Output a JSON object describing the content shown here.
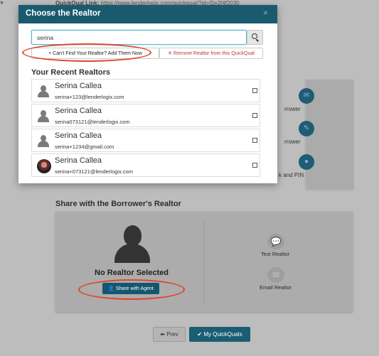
{
  "background": {
    "quickqual_link_label": "QuickQual Link:",
    "quickqual_link_url": "https://www.lenderlogix.com/quickqual/?id=f2e2f4f2030",
    "options": [
      {
        "label": "rrower",
        "icon": "email-icon"
      },
      {
        "label": "rrower",
        "icon": "text-message-icon"
      },
      {
        "label": "k and PIN",
        "icon": "lock-icon"
      }
    ]
  },
  "share_section": {
    "title": "Share with the Borrower's Realtor",
    "no_realtor": "No Realtor Selected",
    "share_button": "Share with Agent",
    "text_realtor": "Text Realtor",
    "email_realtor": "Email Realtor"
  },
  "footer": {
    "prev_label": "Prev",
    "my_quickquals_label": "My QuickQuals"
  },
  "modal": {
    "title": "Choose the Realtor",
    "close_glyph": "×",
    "search": {
      "value": "serina",
      "placeholder": ""
    },
    "add_button": "Can't Find Your Realtor? Add Them Now",
    "remove_button": "Remove Realtor from this QuickQual",
    "recent_title": "Your Recent Realtors",
    "realtors": [
      {
        "name": "Serina Callea",
        "email": "serina+123@lenderlogix.com",
        "avatar": "generic"
      },
      {
        "name": "Serina Callea",
        "email": "serina073121@lenderlogix.com",
        "avatar": "generic"
      },
      {
        "name": "Serina Callea",
        "email": "serina+1234@gmail.com",
        "avatar": "generic"
      },
      {
        "name": "Serina Callea",
        "email": "serina+073121@lenderlogix.com",
        "avatar": "photo"
      }
    ]
  },
  "colors": {
    "primary": "#1a5a6f",
    "danger": "#c9302c",
    "annotation": "#e0442d"
  }
}
